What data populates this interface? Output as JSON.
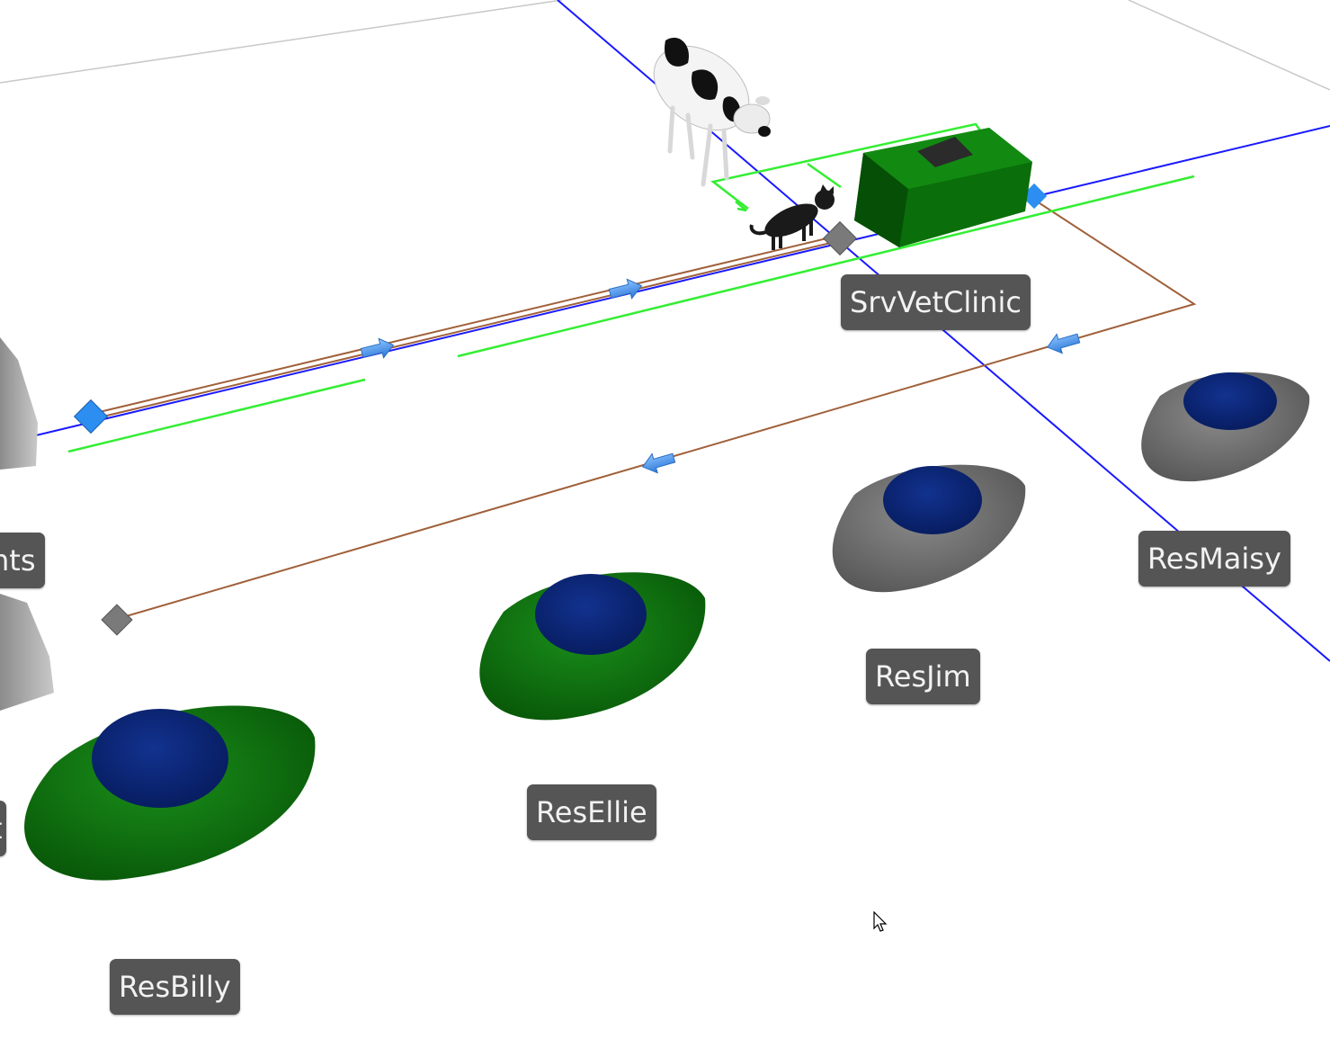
{
  "scene": {
    "labels": {
      "srv_vet_clinic": "SrvVetClinic",
      "res_maisy": "ResMaisy",
      "res_jim": "ResJim",
      "res_ellie": "ResEllie",
      "res_billy": "ResBilly",
      "partial_left_upper": "nts",
      "partial_left_lower": "t"
    },
    "colors": {
      "background": "#ffffff",
      "label_bg": "#555555",
      "label_text": "#f2f2f2",
      "resource_busy": "#0a6e0a",
      "resource_idle": "#6f6f6f",
      "resource_top": "#0a2a7a",
      "server_body": "#0a6e0a",
      "path_blue": "#1a1aff",
      "path_brown": "#a0603a",
      "queue_green": "#33ee33",
      "node_blue": "#2b8ef0",
      "node_gray": "#7a7a7a"
    },
    "icons": [
      "cow-icon",
      "cat-icon",
      "cursor-icon",
      "arrow-right-icon",
      "arrow-left-icon"
    ]
  }
}
